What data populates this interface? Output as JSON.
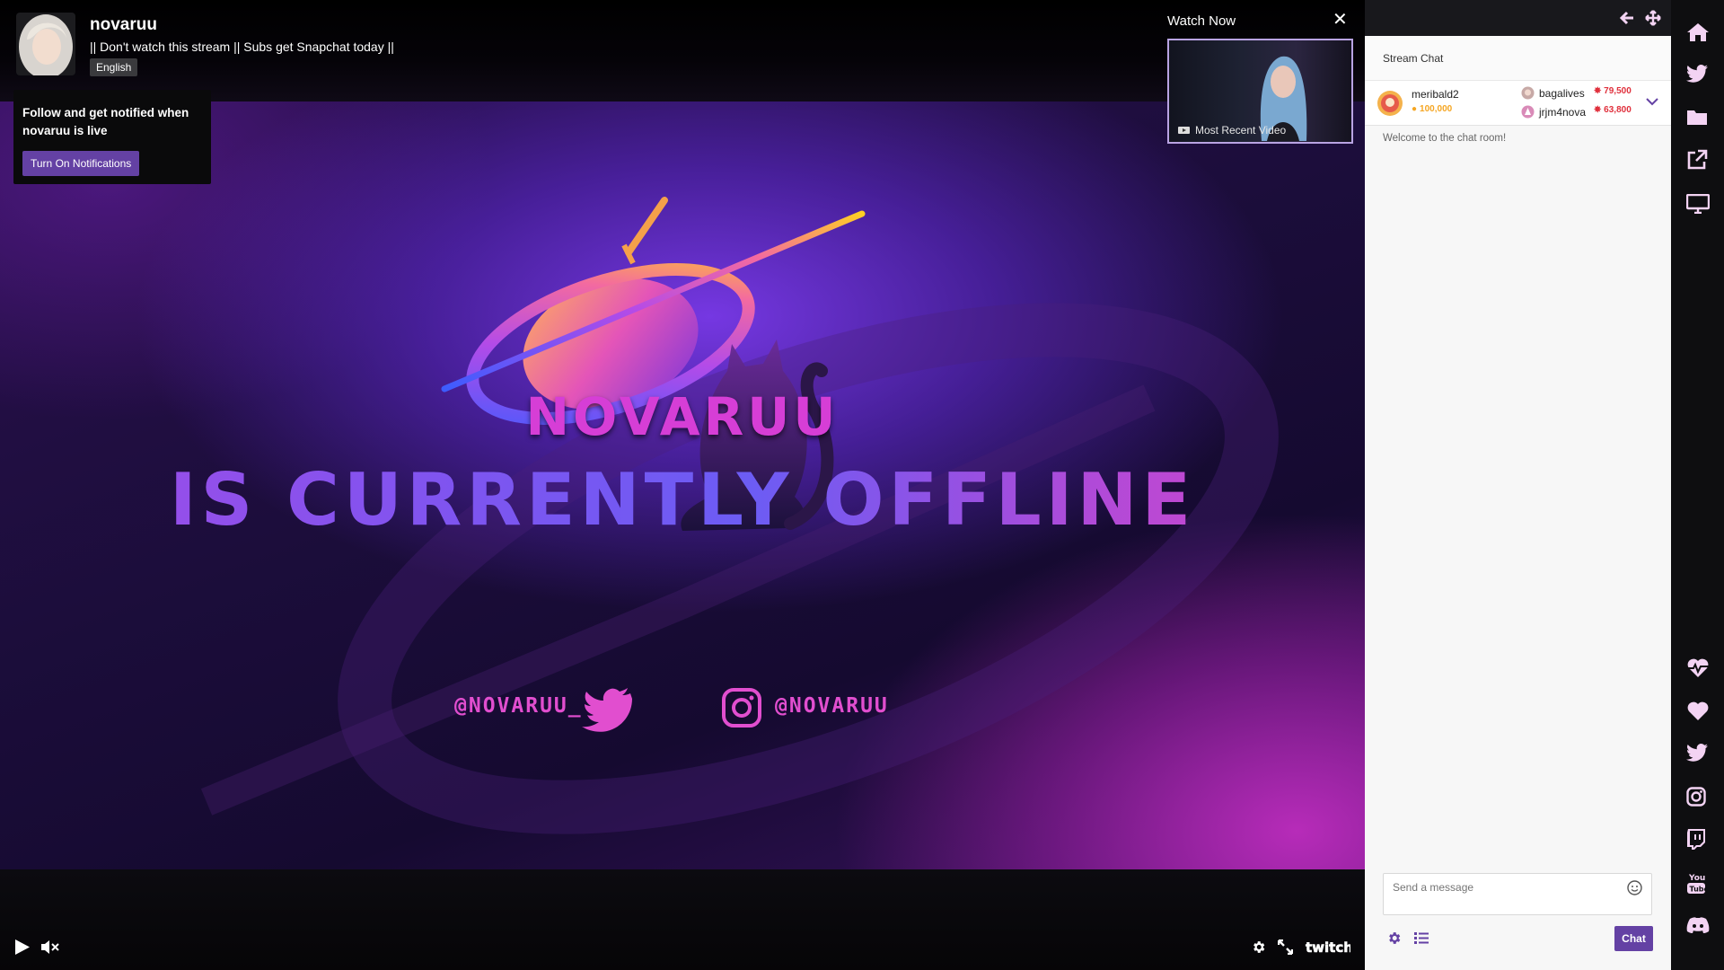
{
  "channel": {
    "name": "novaruu",
    "title": "|| Don't watch this stream || Subs get Snapchat today ||",
    "language": "English"
  },
  "follow_popup": {
    "text": "Follow and get notified when novaruu is live",
    "button_label": "Turn On Notifications"
  },
  "watch_now": {
    "title": "Watch Now",
    "caption": "Most Recent Video"
  },
  "offline_art": {
    "name": "NOVARUU",
    "status": "IS CURRENTLY OFFLINE",
    "twitter_handle": "@NOVARUU_",
    "instagram_handle": "@NOVARUU"
  },
  "chat": {
    "header": "Stream Chat",
    "leaderboard": [
      {
        "user": "meribald2",
        "points": "100,000",
        "color": "#f5a623"
      },
      {
        "user": "bagalives",
        "points": "79,500",
        "color": "#e0303c"
      },
      {
        "user": "jrjm4nova",
        "points": "63,800",
        "color": "#e0303c"
      }
    ],
    "welcome": "Welcome to the chat room!",
    "input_placeholder": "Send a message",
    "send_label": "Chat"
  },
  "player_controls": {
    "brand": "twitch"
  },
  "colors": {
    "accent": "#6441a4",
    "sidebar_icon": "#f3d3f3"
  },
  "sidebar": {
    "top_icons": [
      "home-icon",
      "twitter-icon",
      "folder-icon",
      "external-link-icon",
      "monitor-icon"
    ],
    "bottom_icons": [
      "heartbeat-icon",
      "heart-icon",
      "twitter-icon",
      "instagram-icon",
      "twitch-icon",
      "youtube-icon",
      "discord-icon"
    ]
  }
}
